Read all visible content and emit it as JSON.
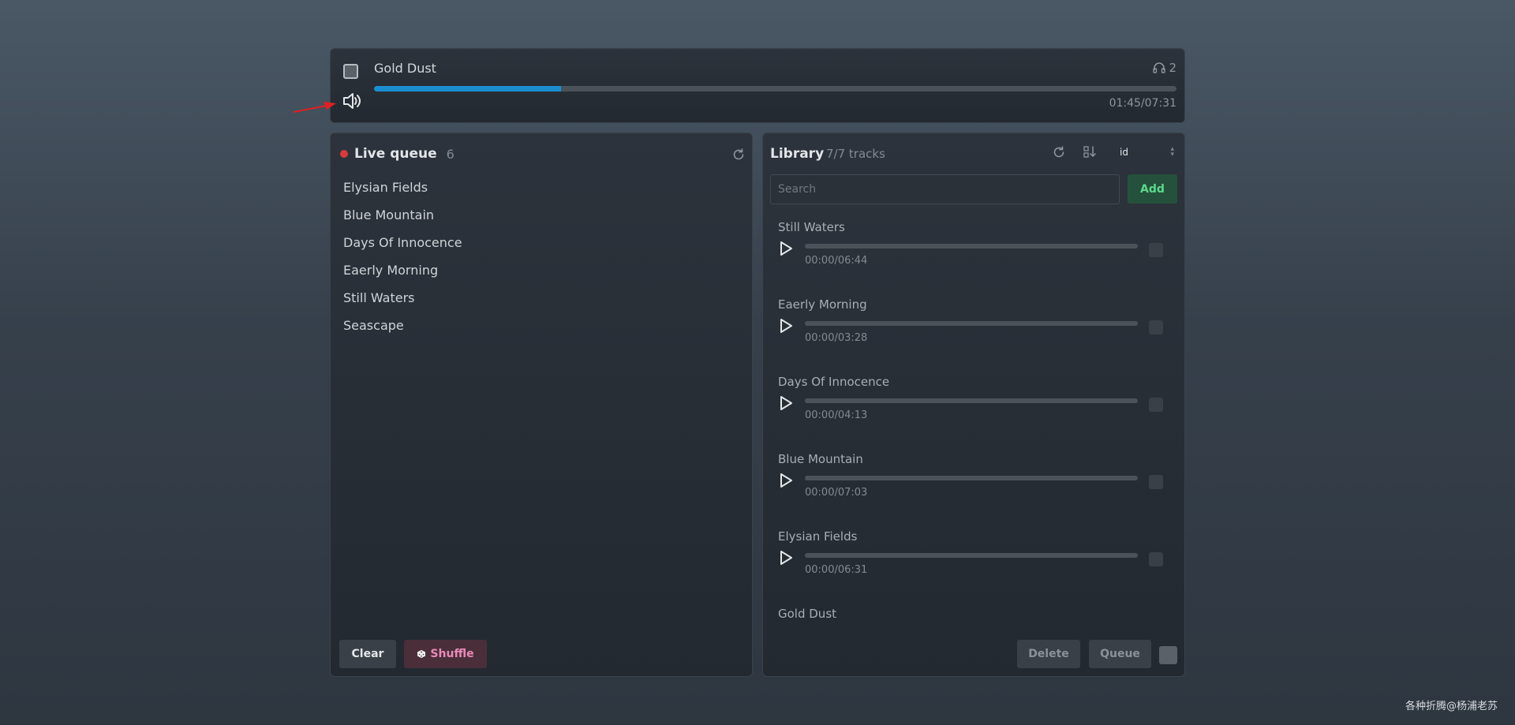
{
  "player": {
    "title": "Gold Dust",
    "listeners": "2",
    "time": "01:45/07:31",
    "progress_fraction": 0.233
  },
  "queue": {
    "title": "Live queue",
    "count": "6",
    "items": [
      "Elysian Fields",
      "Blue Mountain",
      "Days Of Innocence",
      "Eaerly Morning",
      "Still Waters",
      "Seascape"
    ],
    "clear_label": "Clear",
    "shuffle_label": "Shuffle"
  },
  "library": {
    "title": "Library",
    "count": "7/7 tracks",
    "sort_value": "id",
    "search_placeholder": "Search",
    "add_label": "Add",
    "tracks": [
      {
        "title": "Still Waters",
        "time": "00:00/06:44"
      },
      {
        "title": "Eaerly Morning",
        "time": "00:00/03:28"
      },
      {
        "title": "Days Of Innocence",
        "time": "00:00/04:13"
      },
      {
        "title": "Blue Mountain",
        "time": "00:00/07:03"
      },
      {
        "title": "Elysian Fields",
        "time": "00:00/06:31"
      },
      {
        "title": "Gold Dust",
        "time": ""
      }
    ],
    "delete_label": "Delete",
    "queue_label": "Queue"
  },
  "watermark": "各种折腾@杨浦老苏",
  "colors": {
    "accent": "#1b8ed0",
    "live": "#d83a3a",
    "add": "#5cd98c",
    "shuffle": "#e98ab7"
  }
}
